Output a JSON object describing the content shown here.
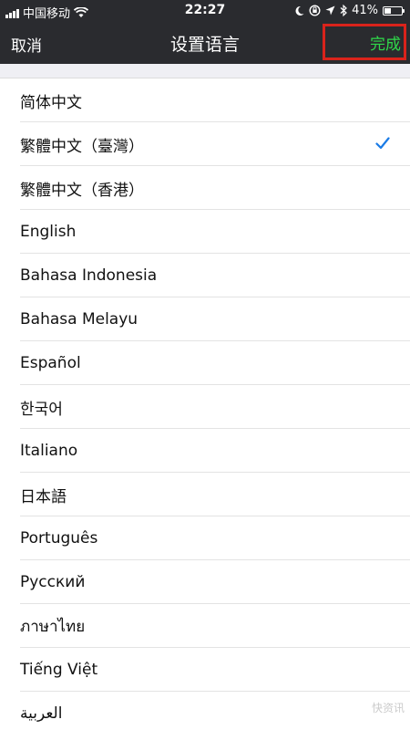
{
  "status_bar": {
    "carrier": "中国移动",
    "time": "22:27",
    "battery_percent": "41%",
    "battery_level": 0.41
  },
  "nav": {
    "cancel_label": "取消",
    "title": "设置语言",
    "done_label": "完成"
  },
  "languages": [
    {
      "label": "简体中文",
      "selected": false
    },
    {
      "label": "繁體中文（臺灣）",
      "selected": true
    },
    {
      "label": "繁體中文（香港）",
      "selected": false
    },
    {
      "label": "English",
      "selected": false
    },
    {
      "label": "Bahasa Indonesia",
      "selected": false
    },
    {
      "label": "Bahasa Melayu",
      "selected": false
    },
    {
      "label": "Español",
      "selected": false
    },
    {
      "label": "한국어",
      "selected": false
    },
    {
      "label": "Italiano",
      "selected": false
    },
    {
      "label": "日本語",
      "selected": false
    },
    {
      "label": "Português",
      "selected": false
    },
    {
      "label": "Русский",
      "selected": false
    },
    {
      "label": "ภาษาไทย",
      "selected": false
    },
    {
      "label": "Tiếng Việt",
      "selected": false
    },
    {
      "label": "العربية",
      "selected": false
    }
  ],
  "colors": {
    "nav_background": "#2a2b2f",
    "done_text": "#2fd84a",
    "highlight_box": "#d9231b",
    "checkmark": "#1a7be6"
  },
  "icons": {
    "signal": "signal-bars-icon",
    "wifi": "wifi-icon",
    "moon": "moon-icon",
    "rotation_lock": "rotation-lock-icon",
    "location": "location-arrow-icon",
    "bluetooth": "bluetooth-icon",
    "battery": "battery-icon",
    "check": "checkmark-icon"
  },
  "watermark": "快资讯"
}
